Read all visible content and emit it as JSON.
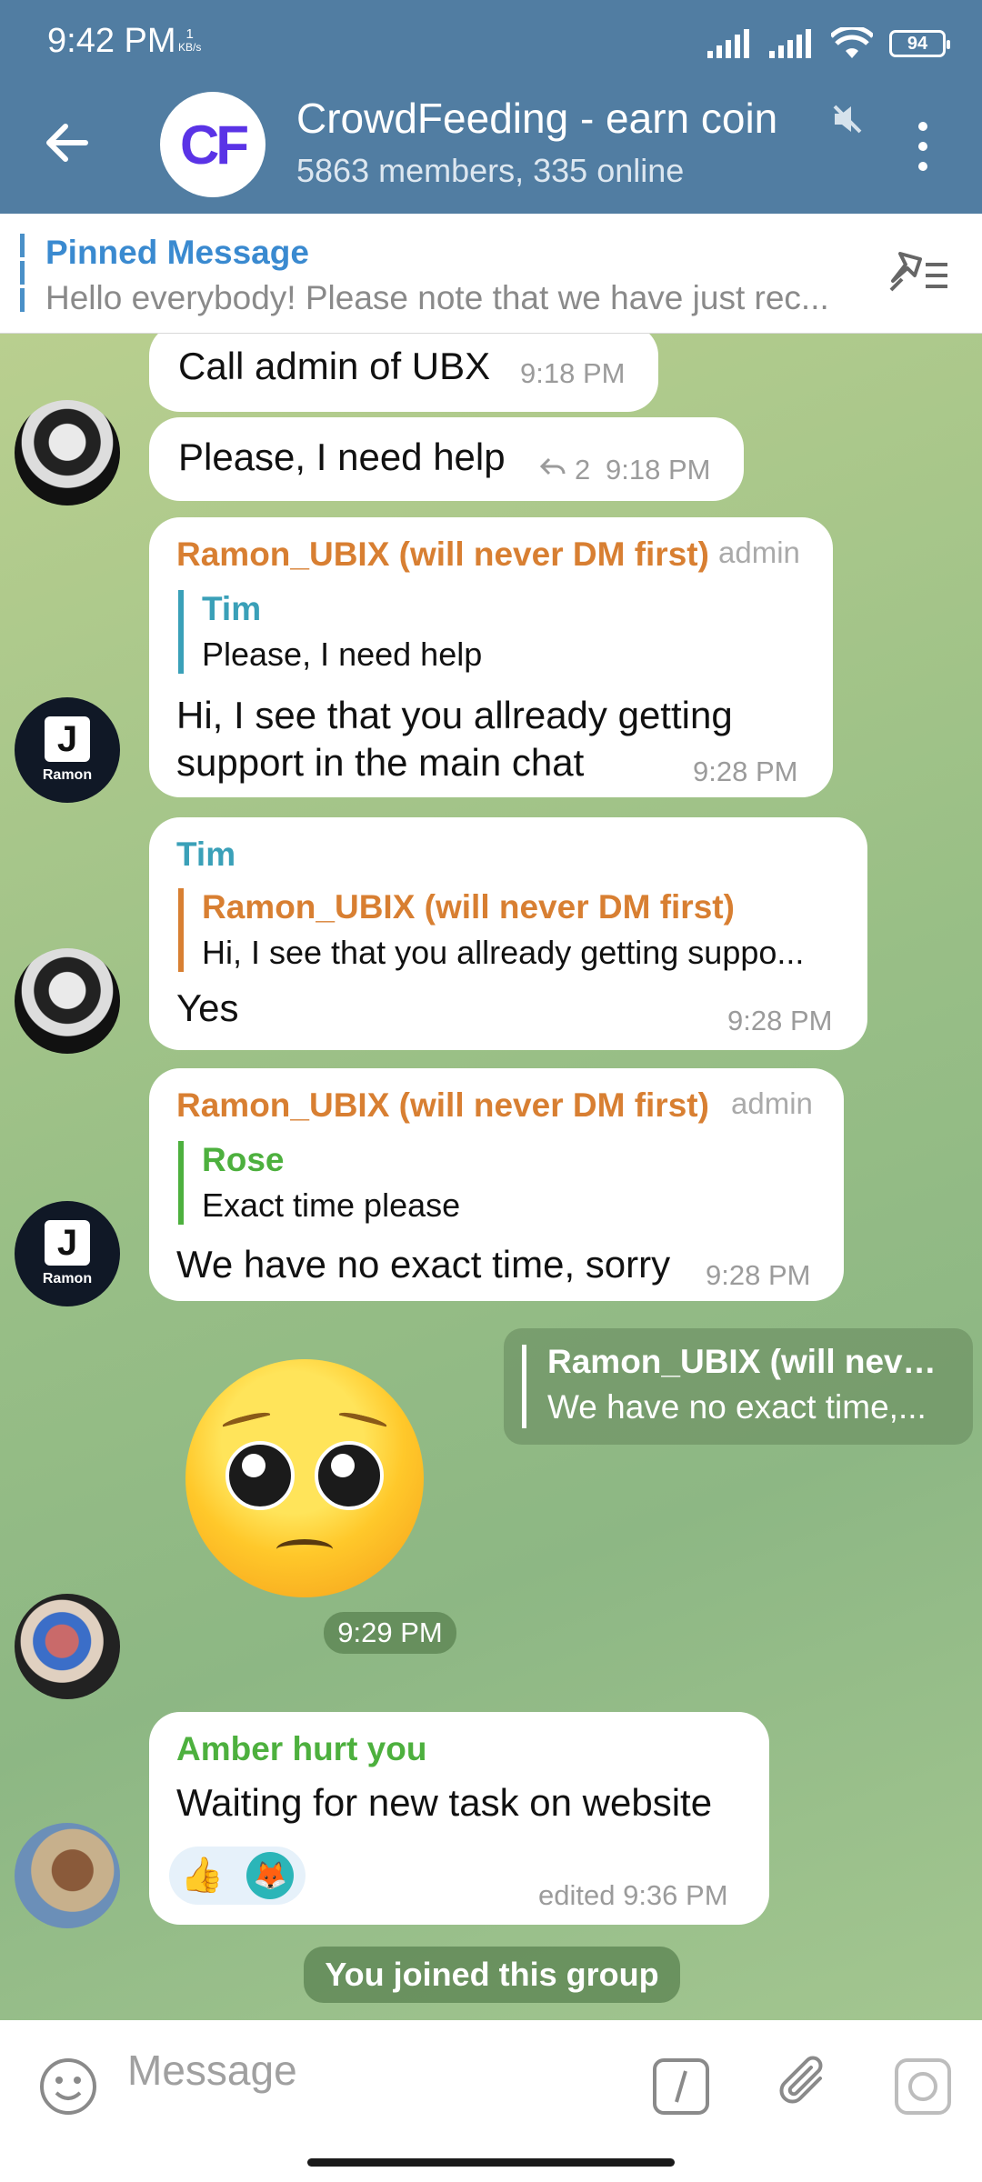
{
  "status_bar": {
    "time": "9:42 PM",
    "speed_value": "1",
    "speed_unit": "KB/s",
    "battery": "94"
  },
  "header": {
    "avatar_initials": "CF",
    "title": "CrowdFeeding - earn coin",
    "subtitle": "5863 members, 335 online"
  },
  "pinned": {
    "title": "Pinned Message",
    "text": "Hello everybody! Please note that we have just rec..."
  },
  "messages": [
    {
      "text": "Call admin of UBX",
      "time": "9:18 PM"
    },
    {
      "text": "Please,  I need help",
      "replies": "2",
      "time": "9:18 PM"
    },
    {
      "sender": "Ramon_UBIX (will never DM first)",
      "badge": "admin",
      "reply_name": "Tim",
      "reply_text": "Please,  I need help",
      "text_line1": "Hi, I see that you allready getting",
      "text_line2": "support in the main chat",
      "time": "9:28 PM",
      "avatar_label": "Ramon"
    },
    {
      "sender": "Tim",
      "reply_name": "Ramon_UBIX (will never DM first)",
      "reply_text": "Hi, I see that you allready getting suppo...",
      "text": "Yes",
      "time": "9:28 PM"
    },
    {
      "sender": "Ramon_UBIX (will never DM first)",
      "badge": "admin",
      "reply_name": "Rose",
      "reply_text": "Exact time please",
      "text": "We have no exact time, sorry",
      "time": "9:28 PM",
      "avatar_label": "Ramon"
    },
    {
      "forward_name": "Ramon_UBIX (will neve...",
      "forward_text": "We have no exact time,...",
      "time": "9:29 PM"
    },
    {
      "sender": "Amber hurt you",
      "text": "Waiting for new task on website",
      "reactions": [
        "👍",
        "🦊"
      ],
      "time": "edited 9:36 PM"
    }
  ],
  "service_message": "You joined this group",
  "composer": {
    "placeholder": "Message"
  },
  "colors": {
    "header": "#517da2",
    "admin_name": "#d87f32",
    "tim_name": "#3aa0b8",
    "green_name": "#4db03e"
  }
}
